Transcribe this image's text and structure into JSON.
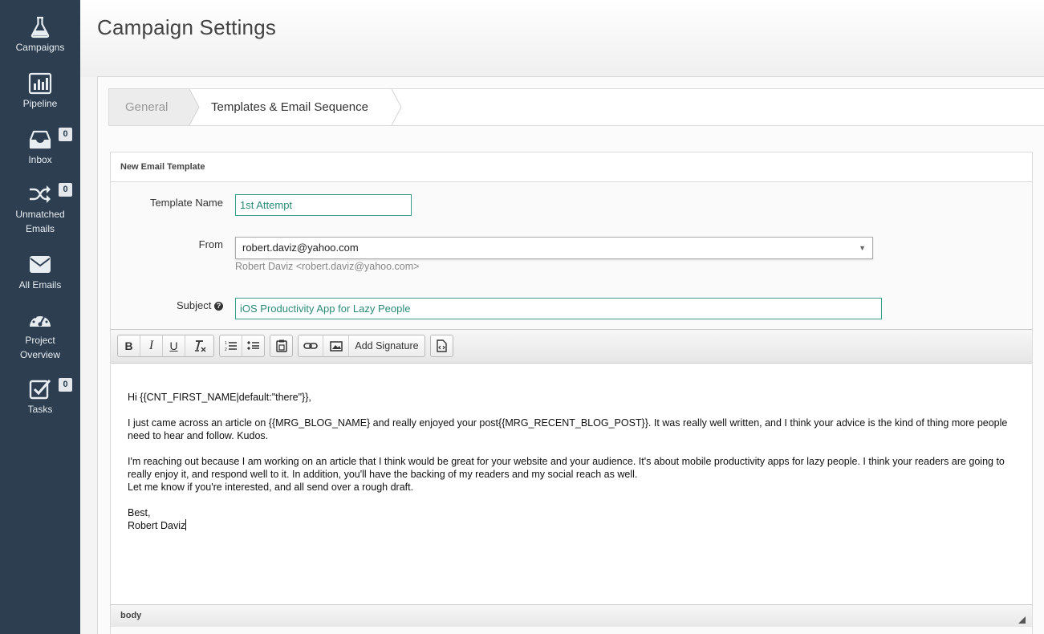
{
  "sidebar": {
    "items": [
      {
        "label": "Campaigns",
        "icon": "flask-icon"
      },
      {
        "label": "Pipeline",
        "icon": "bar-chart-icon"
      },
      {
        "label": "Inbox",
        "icon": "inbox-icon",
        "badge": "0"
      },
      {
        "label": "Unmatched Emails",
        "line1": "Unmatched",
        "line2": "Emails",
        "icon": "shuffle-icon",
        "badge": "0"
      },
      {
        "label": "All Emails",
        "icon": "envelope-icon"
      },
      {
        "label": "Project Overview",
        "line1": "Project",
        "line2": "Overview",
        "icon": "dashboard-icon"
      },
      {
        "label": "Tasks",
        "icon": "checkbox-icon",
        "badge": "0"
      }
    ]
  },
  "header": {
    "title": "Campaign Settings"
  },
  "tabs": [
    {
      "label": "General"
    },
    {
      "label": "Templates & Email Sequence"
    }
  ],
  "template_form": {
    "heading": "New Email Template",
    "template_name_label": "Template Name",
    "template_name_value": "1st Attempt",
    "from_label": "From",
    "from_value": "robert.daviz@yahoo.com",
    "from_hint": "Robert Daviz <robert.daviz@yahoo.com>",
    "subject_label": "Subject",
    "subject_value": "iOS Productivity App for Lazy People"
  },
  "toolbar": {
    "bold": "B",
    "italic": "I",
    "underline": "U",
    "add_signature": "Add Signature"
  },
  "email_body": {
    "greeting": "Hi {{CNT_FIRST_NAME|default:\"there\"}},",
    "para1": "I just came across an article on {{MRG_BLOG_NAME} and really enjoyed your post{{MRG_RECENT_BLOG_POST}}.  It was really well written, and I think your advice is the kind of thing more people need to hear and follow.  Kudos.",
    "para2_line1": "I'm reaching out because I am working on an article that I think would be great for your website and your audience.  It's about mobile productivity apps for lazy people. I think your readers are going to really enjoy it, and respond well to it.  In addition, you'll have the backing of my readers and my social reach as well.",
    "para2_line2": "Let me know if you're interested, and all send over a rough draft.",
    "closing": "Best,",
    "signature": "Robert Daviz"
  },
  "statusbar": {
    "path": "body"
  },
  "colors": {
    "sidebar": "#2d3e50",
    "accent": "#3a9c8c"
  }
}
